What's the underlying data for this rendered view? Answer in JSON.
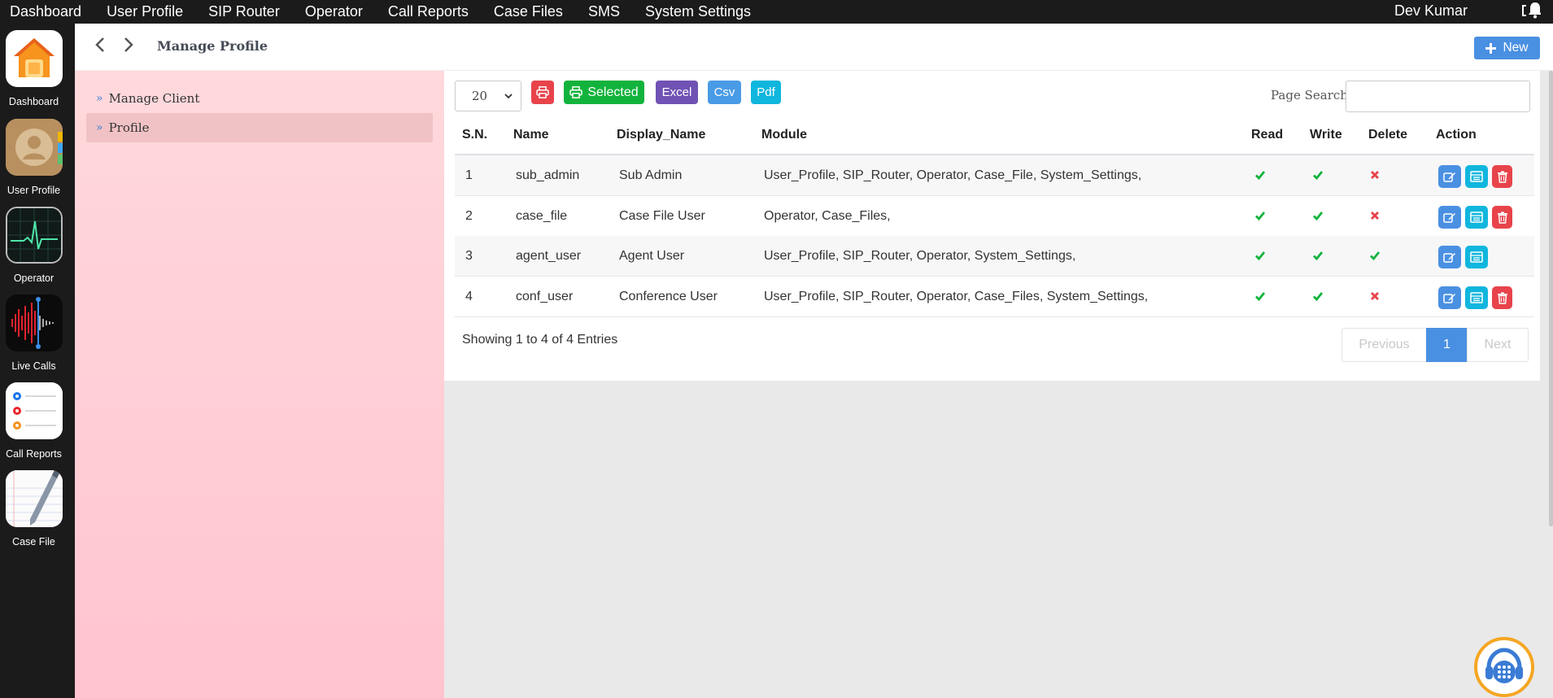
{
  "topnav": {
    "items": [
      "Dashboard",
      "User Profile",
      "SIP Router",
      "Operator",
      "Call Reports",
      "Case Files",
      "SMS",
      "System Settings"
    ],
    "user": "Dev Kumar"
  },
  "dock": {
    "items": [
      {
        "label": "Dashboard",
        "icon": "home-icon"
      },
      {
        "label": "User Profile",
        "icon": "contacts-icon"
      },
      {
        "label": "Operator",
        "icon": "monitor-icon"
      },
      {
        "label": "Live Calls",
        "icon": "waveform-icon"
      },
      {
        "label": "Call Reports",
        "icon": "reminders-icon"
      },
      {
        "label": "Case File",
        "icon": "notepad-icon"
      }
    ]
  },
  "header": {
    "title": "Manage Profile",
    "new_label": "New"
  },
  "leftmenu": {
    "items": [
      "Manage Client",
      "Profile"
    ],
    "active": "Profile"
  },
  "toolbar": {
    "page_size": "20",
    "selected_label": "Selected",
    "excel_label": "Excel",
    "csv_label": "Csv",
    "pdf_label": "Pdf",
    "search_label": "Page Search:",
    "search_value": ""
  },
  "table": {
    "headers": [
      "S.N.",
      "Name",
      "Display_Name",
      "Module",
      "Read",
      "Write",
      "Delete",
      "Action"
    ],
    "rows": [
      {
        "sn": "1",
        "name": "sub_admin",
        "display": "Sub Admin",
        "module": "User_Profile, SIP_Router, Operator, Case_File, System_Settings,",
        "read": true,
        "write": true,
        "delete": false
      },
      {
        "sn": "2",
        "name": "case_file",
        "display": "Case File User",
        "module": "Operator, Case_Files,",
        "read": true,
        "write": true,
        "delete": false
      },
      {
        "sn": "3",
        "name": "agent_user",
        "display": "Agent User",
        "module": "User_Profile, SIP_Router, Operator, System_Settings,",
        "read": true,
        "write": true,
        "delete": true
      },
      {
        "sn": "4",
        "name": "conf_user",
        "display": "Conference User",
        "module": "User_Profile, SIP_Router, Operator, Case_Files, System_Settings,",
        "read": true,
        "write": true,
        "delete": false
      }
    ]
  },
  "footer": {
    "showing": "Showing 1 to 4 of 4 Entries",
    "prev": "Previous",
    "page": "1",
    "next": "Next"
  },
  "colors": {
    "primary": "#4a90e2",
    "success": "#12b33c",
    "danger": "#e8434b",
    "info": "#10b6dd",
    "purple": "#6f52b3"
  }
}
